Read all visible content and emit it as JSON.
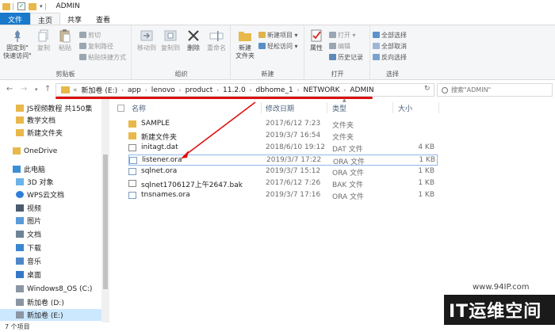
{
  "window": {
    "title": "ADMIN"
  },
  "ribbon_tabs": [
    "文件",
    "主页",
    "共享",
    "查看"
  ],
  "ribbon": {
    "clipboard": {
      "label": "剪贴板",
      "pin": "固定到\"\n快速访问\"",
      "pin_line1": "固定到\"",
      "pin_line2": "快速访问\"",
      "copy": "复制",
      "paste": "粘贴",
      "cut": "剪切",
      "copy_path": "复制路径",
      "paste_shortcut": "粘贴快捷方式"
    },
    "organize": {
      "label": "组织",
      "move_to": "移动到",
      "copy_to": "复制到",
      "delete": "删除",
      "rename": "重命名"
    },
    "new": {
      "label": "新建",
      "new_folder_line1": "新建",
      "new_folder_line2": "文件夹",
      "new_item": "新建项目 ▾",
      "easy_access": "轻松访问 ▾"
    },
    "open": {
      "label": "打开",
      "properties": "属性",
      "open": "打开 ▾",
      "edit": "编辑",
      "history": "历史记录"
    },
    "select": {
      "label": "选择",
      "select_all": "全部选择",
      "select_none": "全部取消",
      "invert": "反向选择"
    }
  },
  "address": {
    "crumbs": [
      "新加卷 (E:)",
      "app",
      "lenovo",
      "product",
      "11.2.0",
      "dbhome_1",
      "NETWORK",
      "ADMIN"
    ],
    "prefix": "«",
    "search_placeholder": "搜索\"ADMIN\""
  },
  "navpane": {
    "items": [
      {
        "label": "JS视频教程 共150集",
        "icon": "folder"
      },
      {
        "label": "教学文档",
        "icon": "folder"
      },
      {
        "label": "新建文件夹",
        "icon": "folder"
      },
      {
        "label": "OneDrive",
        "icon": "onedrive"
      },
      {
        "label": "此电脑",
        "icon": "pc"
      },
      {
        "label": "3D 对象",
        "icon": "cube"
      },
      {
        "label": "WPS云文档",
        "icon": "cloud"
      },
      {
        "label": "视频",
        "icon": "video"
      },
      {
        "label": "图片",
        "icon": "pic"
      },
      {
        "label": "文档",
        "icon": "doc"
      },
      {
        "label": "下载",
        "icon": "down"
      },
      {
        "label": "音乐",
        "icon": "music"
      },
      {
        "label": "桌面",
        "icon": "desk"
      },
      {
        "label": "Windows8_OS (C:)",
        "icon": "drive"
      },
      {
        "label": "新加卷 (D:)",
        "icon": "drive"
      },
      {
        "label": "新加卷 (E:)",
        "icon": "drive"
      }
    ]
  },
  "columns": {
    "name": "名称",
    "date": "修改日期",
    "type": "类型",
    "size": "大小"
  },
  "files": [
    {
      "name": "SAMPLE",
      "date": "2017/6/12 7:23",
      "type": "文件夹",
      "size": "",
      "icon": "folder"
    },
    {
      "name": "新建文件夹",
      "date": "2019/3/7 16:54",
      "type": "文件夹",
      "size": "",
      "icon": "folder"
    },
    {
      "name": "initagt.dat",
      "date": "2018/6/10 19:12",
      "type": "DAT 文件",
      "size": "4 KB",
      "icon": "file"
    },
    {
      "name": "listener.ora",
      "date": "2019/3/7 17:22",
      "type": "ORA 文件",
      "size": "1 KB",
      "icon": "ora"
    },
    {
      "name": "sqlnet.ora",
      "date": "2019/3/7 15:12",
      "type": "ORA 文件",
      "size": "1 KB",
      "icon": "ora"
    },
    {
      "name": "sqlnet1706127上午2647.bak",
      "date": "2017/6/12 7:26",
      "type": "BAK 文件",
      "size": "1 KB",
      "icon": "file"
    },
    {
      "name": "tnsnames.ora",
      "date": "2019/3/7 17:16",
      "type": "ORA 文件",
      "size": "1 KB",
      "icon": "ora"
    }
  ],
  "status": {
    "count": "7 个项目"
  },
  "watermark": {
    "url": "www.94IP.com",
    "logo": "IT运维空间"
  },
  "colors": {
    "file_tab": "#1979ca",
    "annotation": "#dd1111",
    "selection": "#cce8ff",
    "folder": "#e8b84a"
  }
}
